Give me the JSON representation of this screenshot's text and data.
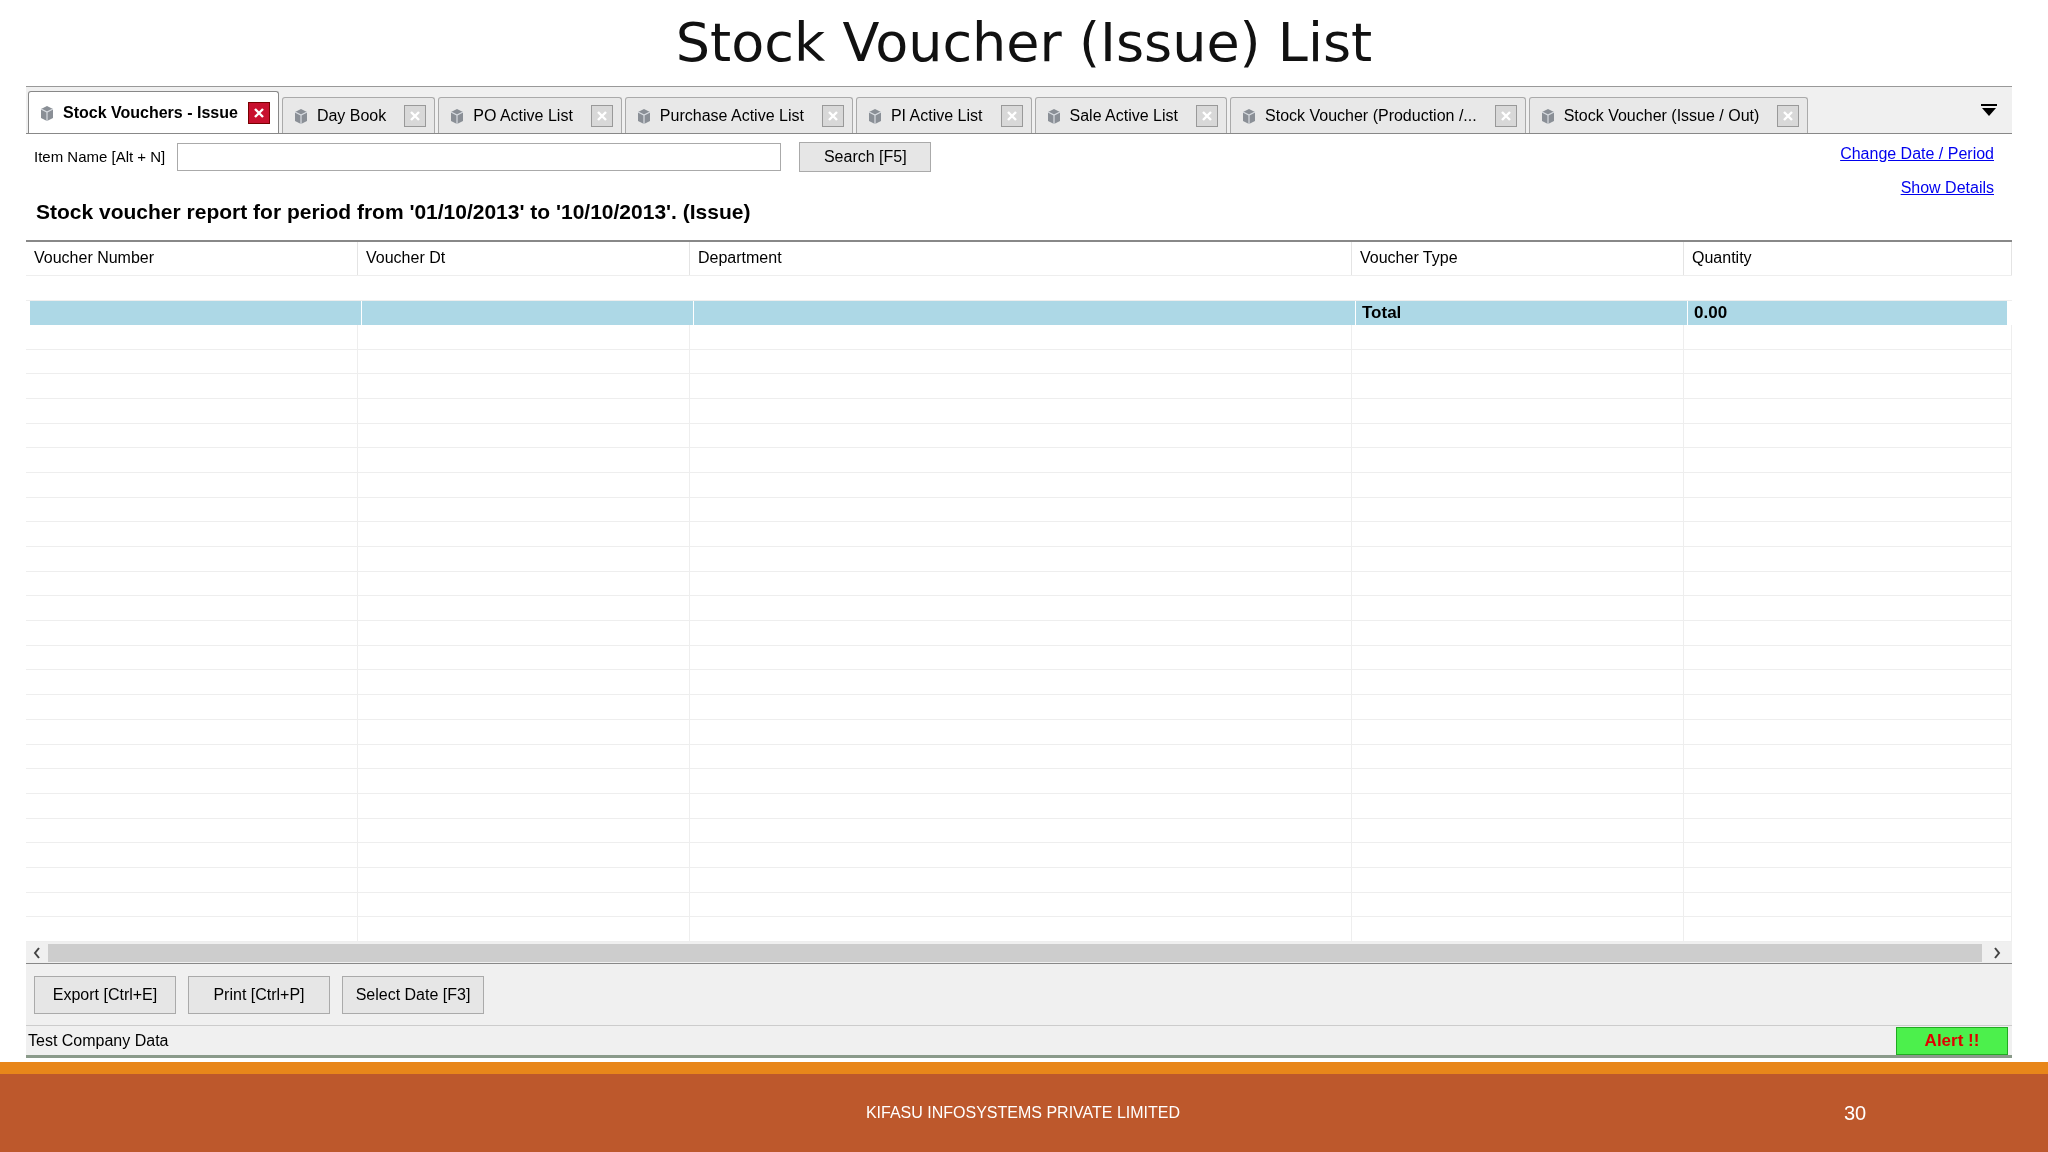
{
  "slide": {
    "title": "Stock Voucher (Issue) List",
    "footer": "KIFASU INFOSYSTEMS PRIVATE LIMITED",
    "page_number": "30"
  },
  "tabs": [
    {
      "label": "Stock Vouchers - Issue",
      "selected": true
    },
    {
      "label": "Day Book",
      "selected": false
    },
    {
      "label": "PO Active List",
      "selected": false
    },
    {
      "label": "Purchase Active List",
      "selected": false
    },
    {
      "label": "PI Active List",
      "selected": false
    },
    {
      "label": "Sale Active List",
      "selected": false
    },
    {
      "label": "Stock Voucher (Production /...",
      "selected": false
    },
    {
      "label": "Stock Voucher (Issue / Out)",
      "selected": false
    }
  ],
  "search": {
    "label": "Item Name [Alt + N]",
    "button": "Search [F5]"
  },
  "links": [
    "Change Date / Period",
    "Show Details"
  ],
  "report_heading": "Stock voucher report for period from '01/10/2013' to '10/10/2013'. (Issue)",
  "table": {
    "columns": [
      "Voucher Number",
      "Voucher Dt",
      "Department",
      "Voucher Type",
      "Quantity"
    ],
    "rows": [
      {
        "kind": "blank",
        "selected": false
      },
      {
        "kind": "total",
        "selected": true,
        "cells": [
          "",
          "",
          "",
          "Total",
          "0.00"
        ]
      }
    ]
  },
  "buttons": [
    "Export [Ctrl+E]",
    "Print [Ctrl+P]",
    "Select Date [F3]"
  ],
  "status_bar": {
    "text": "Test Company Data",
    "alert": "Alert !!"
  }
}
